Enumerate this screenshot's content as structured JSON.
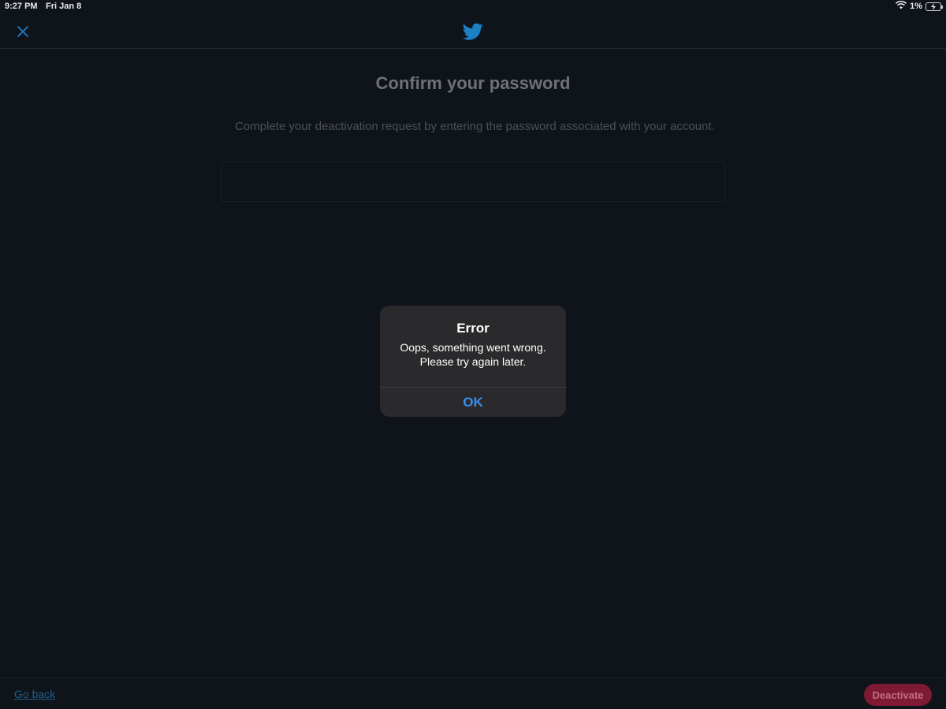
{
  "status_bar": {
    "time": "9:27 PM",
    "date": "Fri Jan 8",
    "battery_text": "1%"
  },
  "header": {
    "close_icon": "close-icon",
    "logo_icon": "twitter-bird-icon"
  },
  "main": {
    "title": "Confirm your password",
    "description": "Complete your deactivation request by entering the password associated with your account.",
    "password_value": "",
    "password_placeholder": ""
  },
  "alert": {
    "title": "Error",
    "message": "Oops, something went wrong. Please try again later.",
    "ok_label": "OK"
  },
  "footer": {
    "go_back_label": "Go back",
    "deactivate_label": "Deactivate"
  },
  "colors": {
    "background": "#0f141b",
    "twitter_blue": "#1d7fc4",
    "alert_link": "#3a8ef0",
    "deactivate_bg": "#7e1a34"
  }
}
